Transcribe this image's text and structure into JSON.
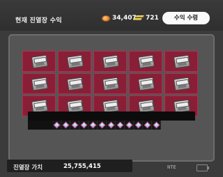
{
  "header": {
    "title": "현재 진열장 수익",
    "gold_amount": "34,407",
    "bar_amount": "721",
    "collect_button_label": "수익 수령",
    "icons": [
      "gold-coin-icon",
      "gold-bar-icon"
    ]
  },
  "shelf": {
    "rows": 3,
    "columns": 5,
    "item_icon": "supply-crate-icon",
    "slot_color": "#8a1e36",
    "gem_slots": 12,
    "gem_icon": "diamond-icon"
  },
  "footer": {
    "value_label": "진열장 가치",
    "value_amount": "25,755,415",
    "logo_text": "NTE",
    "battery_icon": "battery-icon"
  }
}
